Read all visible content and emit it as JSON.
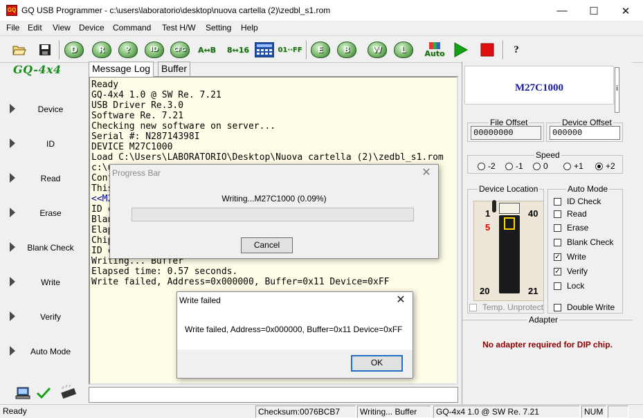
{
  "window": {
    "app_icon_text": "GQ",
    "title": "GQ USB Programmer - c:\\users\\laboratorio\\desktop\\nuova cartella (2)\\zedbl_s1.rom",
    "minimize": "—",
    "maximize": "☐",
    "close": "✕"
  },
  "menu": [
    "File",
    "Edit",
    "View",
    "Device",
    "Command",
    "Test H/W",
    "Setting",
    "Help"
  ],
  "toolbar": {
    "open_icon": "folder-open-icon",
    "save_icon": "save-icon",
    "D": "D",
    "R": "R",
    "question": "?",
    "ID": "ID",
    "CFG": "CFG",
    "AB": "A↔B",
    "816": "8↔16",
    "01FF": "01··FF",
    "E": "E",
    "B": "B",
    "W": "W",
    "L": "L",
    "Auto": "Auto",
    "help": "?"
  },
  "left_panel": {
    "logo": "GQ-4x4",
    "items": [
      "Device",
      "ID",
      "Read",
      "Erase",
      "Blank Check",
      "Write",
      "Verify",
      "Auto Mode"
    ]
  },
  "tabs": [
    "Message Log",
    "Buffer"
  ],
  "log_lines": [
    "Ready",
    "GQ-4x4 1.0 @ SW Re. 7.21",
    "USB Driver Re.3.0",
    "Software Re. 7.21",
    "Checking new software on server...",
    "Serial #: N28714398I",
    "DEVICE M27C1000",
    "Load C:\\Users\\LABORATORIO\\Desktop\\Nuova cartella (2)\\zedbl_s1.rom",
    "c:\\u",
    "Conf",
    "This",
    "<<M2",
    "ID c",
    "Blan",
    "Elap",
    "Chip",
    "ID c",
    "Writing... Buffer",
    "Elapsed time: 0.57 seconds.",
    "Write failed, Address=0x000000, Buffer=0x11 Device=0xFF"
  ],
  "right_panel": {
    "chip_name": "M27C1000",
    "i_button": "i",
    "file_offset_label": "File Offset",
    "file_offset_value": "00000000",
    "device_offset_label": "Device Offset",
    "device_offset_value": "000000",
    "speed_label": "Speed",
    "speed_options": [
      "-2",
      "-1",
      "0",
      "+1",
      "+2"
    ],
    "speed_selected": "+2",
    "device_location_label": "Device Location",
    "pin1": "1",
    "pin40": "40",
    "pin5": "5",
    "pin20": "20",
    "pin21": "21",
    "temp_unprotect": "Temp. Unprotect",
    "auto_mode_label": "Auto Mode",
    "auto_mode_items": [
      {
        "label": "ID Check",
        "checked": false
      },
      {
        "label": "Read",
        "checked": false
      },
      {
        "label": "Erase",
        "checked": false
      },
      {
        "label": "Blank Check",
        "checked": false
      },
      {
        "label": "Write",
        "checked": true
      },
      {
        "label": "Verify",
        "checked": true
      },
      {
        "label": "Lock",
        "checked": false
      }
    ],
    "double_write": "Double Write",
    "adapter_label": "Adapter",
    "adapter_text": "No adapter required for DIP chip.",
    "adapter_color": "#8b0000"
  },
  "status_bar": {
    "ready": "Ready",
    "checksum": "Checksum:0076BCB7",
    "activity": "Writing... Buffer",
    "version": "GQ-4x4 1.0 @ SW Re. 7.21",
    "num": "NUM"
  },
  "progress_dialog": {
    "title": "Progress Bar",
    "message": "Writing...M27C1000 (0.09%)",
    "progress": 0.0009,
    "cancel": "Cancel",
    "close": "✕"
  },
  "error_dialog": {
    "title": "Write failed",
    "message": "Write failed, Address=0x000000, Buffer=0x11 Device=0xFF",
    "ok": "OK",
    "close": "✕"
  }
}
